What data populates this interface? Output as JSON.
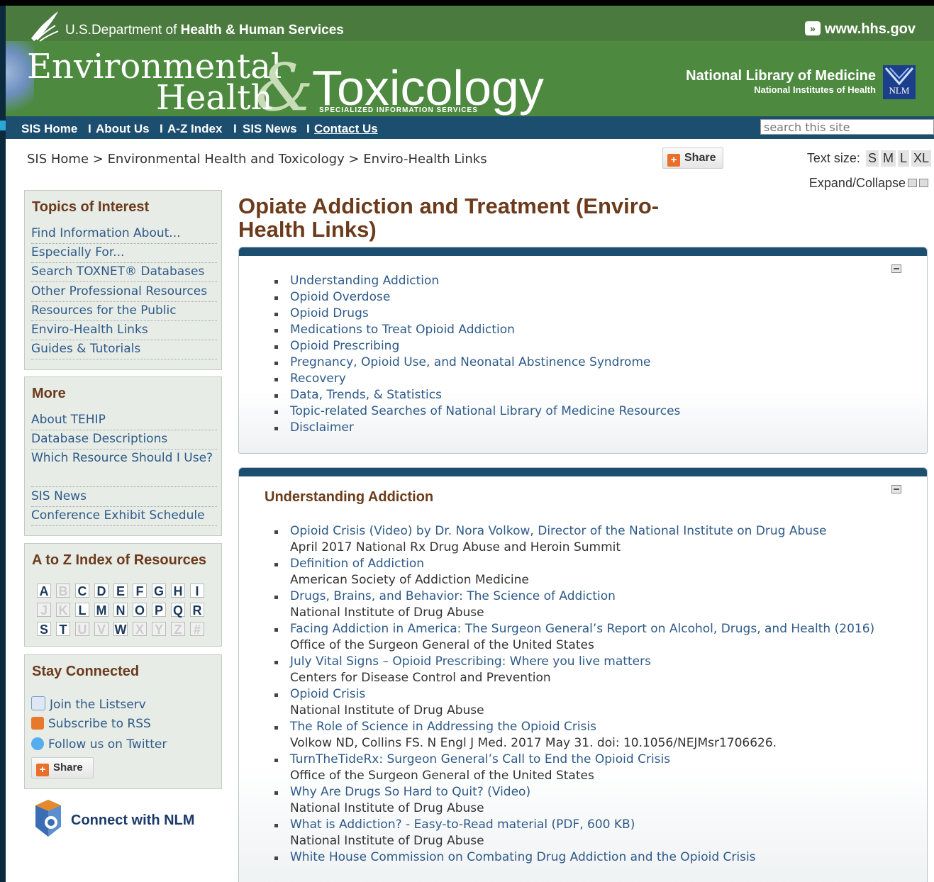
{
  "header": {
    "hhs_prefix": "U.S.Department of",
    "hhs_name": "Health & Human Services",
    "hhs_link": "www.hhs.gov",
    "title_environmental": "Environmental",
    "title_health": "Health",
    "title_amp": "&",
    "title_toxicology": "Toxicology",
    "title_sis": "SPECIALIZED INFORMATION SERVICES",
    "nlm_name": "National Library of Medicine",
    "nlm_sub": "National Institutes of Health",
    "nlm_logo": "NLM"
  },
  "nav": {
    "items": [
      "SIS Home",
      "About Us",
      "A-Z Index",
      "SIS News",
      "Contact Us"
    ],
    "separator": "I",
    "search_placeholder": "search this site"
  },
  "breadcrumb": "SIS Home > Environmental Health and Toxicology > Enviro-Health Links",
  "share_label": "Share",
  "text_size": {
    "label": "Text size:",
    "options": [
      "S",
      "M",
      "L",
      "XL"
    ]
  },
  "expand_label": "Expand/Collapse",
  "sidebar": {
    "topics": {
      "title": "Topics of Interest",
      "links": [
        "Find Information About...",
        "Especially For...",
        "Search TOXNET® Databases",
        "Other Professional Resources",
        "Resources for the Public",
        "Enviro-Health Links",
        "Guides & Tutorials"
      ]
    },
    "more": {
      "title": "More",
      "links": [
        "About TEHIP",
        "Database Descriptions",
        "Which Resource Should I Use?",
        "SIS News",
        "Conference Exhibit Schedule"
      ]
    },
    "az": {
      "title": "A to Z Index of Resources",
      "letters": [
        "A",
        "B",
        "C",
        "D",
        "E",
        "F",
        "G",
        "H",
        "I",
        "J",
        "K",
        "L",
        "M",
        "N",
        "O",
        "P",
        "Q",
        "R",
        "S",
        "T",
        "U",
        "V",
        "W",
        "X",
        "Y",
        "Z",
        "#"
      ],
      "disabled": [
        "B",
        "J",
        "K",
        "U",
        "V",
        "X",
        "Y",
        "Z",
        "#"
      ]
    },
    "connected": {
      "title": "Stay Connected",
      "items": [
        "Join the Listserv",
        "Subscribe to RSS",
        "Follow us on Twitter"
      ],
      "share": "Share"
    },
    "connect_nlm": "Connect with NLM"
  },
  "main": {
    "title": "Opiate Addiction and Treatment (Enviro-Health Links)",
    "toc": [
      "Understanding Addiction",
      "Opioid Overdose",
      "Opioid Drugs",
      "Medications to Treat Opioid Addiction",
      "Opioid Prescribing",
      "Pregnancy, Opioid Use, and Neonatal Abstinence Syndrome",
      "Recovery",
      "Data, Trends, & Statistics",
      "Topic-related Searches of National Library of Medicine Resources",
      "Disclaimer"
    ],
    "section": {
      "title": "Understanding Addiction",
      "items": [
        {
          "link": "Opioid Crisis (Video) by Dr. Nora Volkow, Director of the National Institute on Drug Abuse",
          "source": "April 2017 National Rx Drug Abuse and Heroin Summit"
        },
        {
          "link": "Definition of Addiction",
          "source": "American Society of Addiction Medicine"
        },
        {
          "link": "Drugs, Brains, and Behavior: The Science of Addiction",
          "source": "National Institute of Drug Abuse"
        },
        {
          "link": "Facing Addiction in America: The Surgeon General’s Report on Alcohol, Drugs, and Health (2016)",
          "source": "Office of the Surgeon General of the United States"
        },
        {
          "link": "July Vital Signs – Opioid Prescribing: Where you live matters",
          "source": "Centers for Disease Control and Prevention"
        },
        {
          "link": "Opioid Crisis",
          "source": "National Institute of Drug Abuse"
        },
        {
          "link": "The Role of Science in Addressing the Opioid Crisis",
          "source": "Volkow ND, Collins FS. N Engl J Med. 2017 May 31. doi: 10.1056/NEJMsr1706626."
        },
        {
          "link": "TurnTheTideRx: Surgeon General’s Call to End the Opioid Crisis",
          "source": "Office of the Surgeon General of the United States"
        },
        {
          "link": "Why Are Drugs So Hard to Quit? (Video)",
          "source": "National Institute of Drug Abuse"
        },
        {
          "link": "What is Addiction? - Easy-to-Read material (PDF, 600 KB)",
          "source": "National Institute of Drug Abuse"
        },
        {
          "link": "White House Commission on Combating Drug Addiction and the Opioid Crisis",
          "source": ""
        }
      ]
    }
  },
  "colors": {
    "header_green": "#4d8a3f",
    "nav_blue": "#1b4e6f",
    "title_brown": "#6b3b1b",
    "link_blue": "#2e5a88"
  }
}
